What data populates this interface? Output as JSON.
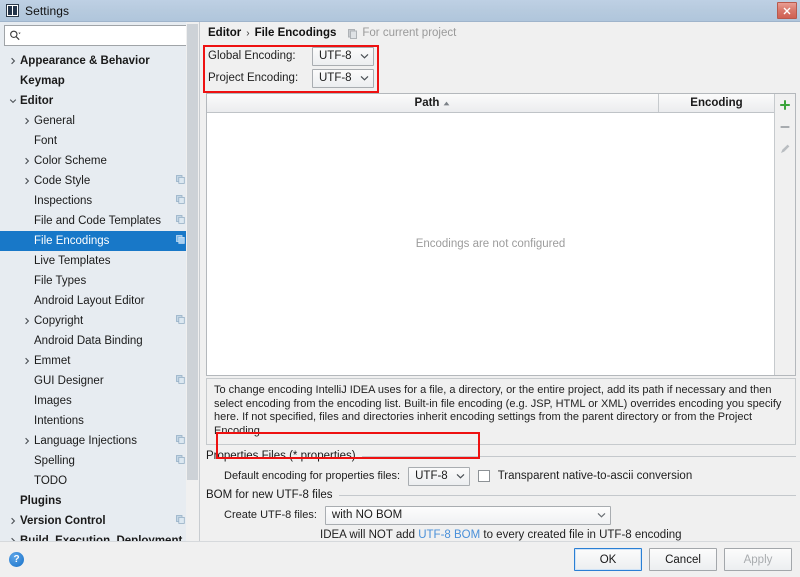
{
  "window": {
    "title": "Settings",
    "app_icon": "intellij-idea-icon",
    "close_label": "✕"
  },
  "search": {
    "value": "",
    "placeholder": "",
    "icon": "search-icon"
  },
  "sidebar": {
    "items": [
      {
        "label": "Appearance & Behavior",
        "level": 0,
        "bold": true,
        "arrow": "right",
        "badge": false,
        "selected": false
      },
      {
        "label": "Keymap",
        "level": 0,
        "bold": true,
        "arrow": "none",
        "badge": false,
        "selected": false
      },
      {
        "label": "Editor",
        "level": 0,
        "bold": true,
        "arrow": "down",
        "badge": false,
        "selected": false
      },
      {
        "label": "General",
        "level": 1,
        "bold": false,
        "arrow": "right",
        "badge": false,
        "selected": false
      },
      {
        "label": "Font",
        "level": 1,
        "bold": false,
        "arrow": "none",
        "badge": false,
        "selected": false
      },
      {
        "label": "Color Scheme",
        "level": 1,
        "bold": false,
        "arrow": "right",
        "badge": false,
        "selected": false
      },
      {
        "label": "Code Style",
        "level": 1,
        "bold": false,
        "arrow": "right",
        "badge": true,
        "selected": false
      },
      {
        "label": "Inspections",
        "level": 1,
        "bold": false,
        "arrow": "none",
        "badge": true,
        "selected": false
      },
      {
        "label": "File and Code Templates",
        "level": 1,
        "bold": false,
        "arrow": "none",
        "badge": true,
        "selected": false
      },
      {
        "label": "File Encodings",
        "level": 1,
        "bold": false,
        "arrow": "none",
        "badge": true,
        "selected": true
      },
      {
        "label": "Live Templates",
        "level": 1,
        "bold": false,
        "arrow": "none",
        "badge": false,
        "selected": false
      },
      {
        "label": "File Types",
        "level": 1,
        "bold": false,
        "arrow": "none",
        "badge": false,
        "selected": false
      },
      {
        "label": "Android Layout Editor",
        "level": 1,
        "bold": false,
        "arrow": "none",
        "badge": false,
        "selected": false
      },
      {
        "label": "Copyright",
        "level": 1,
        "bold": false,
        "arrow": "right",
        "badge": true,
        "selected": false
      },
      {
        "label": "Android Data Binding",
        "level": 1,
        "bold": false,
        "arrow": "none",
        "badge": false,
        "selected": false
      },
      {
        "label": "Emmet",
        "level": 1,
        "bold": false,
        "arrow": "right",
        "badge": false,
        "selected": false
      },
      {
        "label": "GUI Designer",
        "level": 1,
        "bold": false,
        "arrow": "none",
        "badge": true,
        "selected": false
      },
      {
        "label": "Images",
        "level": 1,
        "bold": false,
        "arrow": "none",
        "badge": false,
        "selected": false
      },
      {
        "label": "Intentions",
        "level": 1,
        "bold": false,
        "arrow": "none",
        "badge": false,
        "selected": false
      },
      {
        "label": "Language Injections",
        "level": 1,
        "bold": false,
        "arrow": "right",
        "badge": true,
        "selected": false
      },
      {
        "label": "Spelling",
        "level": 1,
        "bold": false,
        "arrow": "none",
        "badge": true,
        "selected": false
      },
      {
        "label": "TODO",
        "level": 1,
        "bold": false,
        "arrow": "none",
        "badge": false,
        "selected": false
      },
      {
        "label": "Plugins",
        "level": 0,
        "bold": true,
        "arrow": "none",
        "badge": false,
        "selected": false
      },
      {
        "label": "Version Control",
        "level": 0,
        "bold": true,
        "arrow": "right",
        "badge": true,
        "selected": false
      },
      {
        "label": "Build, Execution, Deployment",
        "level": 0,
        "bold": true,
        "arrow": "right",
        "badge": false,
        "selected": false
      }
    ]
  },
  "breadcrumb": {
    "parent": "Editor",
    "separator": "›",
    "current": "File Encodings",
    "scope_note": "For current project",
    "scope_icon": "project-scope-icon"
  },
  "encodings": {
    "global_label": "Global Encoding:",
    "global_value": "UTF-8",
    "project_label": "Project Encoding:",
    "project_value": "UTF-8"
  },
  "table": {
    "columns": {
      "path": "Path",
      "encoding": "Encoding"
    },
    "sort_indicator": "ascending",
    "rows": [],
    "empty_message": "Encodings are not configured",
    "tools": [
      {
        "name": "add-button",
        "glyph": "+"
      },
      {
        "name": "remove-button",
        "glyph": "−"
      },
      {
        "name": "edit-button",
        "glyph": "✎"
      }
    ]
  },
  "description": "To change encoding IntelliJ IDEA uses for a file, a directory, or the entire project, add its path if necessary and then select encoding from the encoding list. Built-in file encoding (e.g. JSP, HTML or XML) overrides encoding you specify here. If not specified, files and directories inherit encoding settings from the parent directory or from the Project Encoding.",
  "properties_group": {
    "title": "Properties Files (*.properties)",
    "default_encoding_label": "Default encoding for properties files:",
    "default_encoding_value": "UTF-8",
    "transparent_label": "Transparent native-to-ascii conversion",
    "transparent_checked": false
  },
  "bom_group": {
    "title": "BOM for new UTF-8 files",
    "create_label": "Create UTF-8 files:",
    "create_value": "with NO BOM",
    "hint_before": "IDEA will NOT add ",
    "hint_link": "UTF-8 BOM",
    "hint_after": " to every created file in UTF-8 encoding"
  },
  "footer": {
    "help_glyph": "?",
    "ok": "OK",
    "cancel": "Cancel",
    "apply": "Apply"
  },
  "colors": {
    "accent": "#1878c8",
    "annotation": "#ee1111",
    "link": "#4a90d9",
    "sidebar_bg": "#e7ecf1"
  }
}
